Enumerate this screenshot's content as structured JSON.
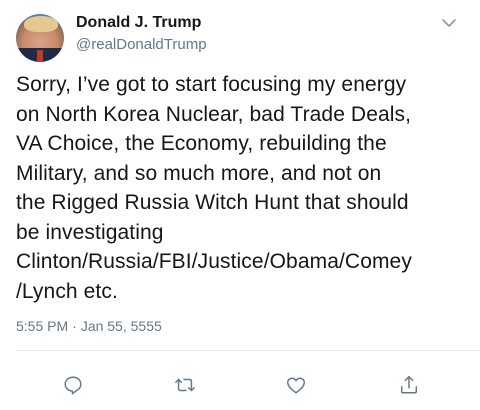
{
  "author": {
    "name": "Donald J. Trump",
    "handle": "@realDonaldTrump"
  },
  "tweet": {
    "text": "Sorry, I’ve got to start focusing my energy\non North Korea Nuclear, bad Trade Deals,\nVA Choice, the Economy, rebuilding the\nMilitary, and so much more, and not on\nthe Rigged Russia Witch Hunt that should\nbe investigating\nClinton/Russia/FBI/Justice/Obama/Comey\n/Lynch etc.",
    "time": "5:55 PM",
    "separator": "·",
    "date": "Jan 55, 5555"
  },
  "icons": {
    "caret": "chevron-down-icon",
    "reply": "reply-icon",
    "retweet": "retweet-icon",
    "like": "heart-icon",
    "share": "share-icon"
  },
  "colors": {
    "text": "#14171a",
    "secondary": "#657786",
    "divider": "#e1e8ed"
  }
}
